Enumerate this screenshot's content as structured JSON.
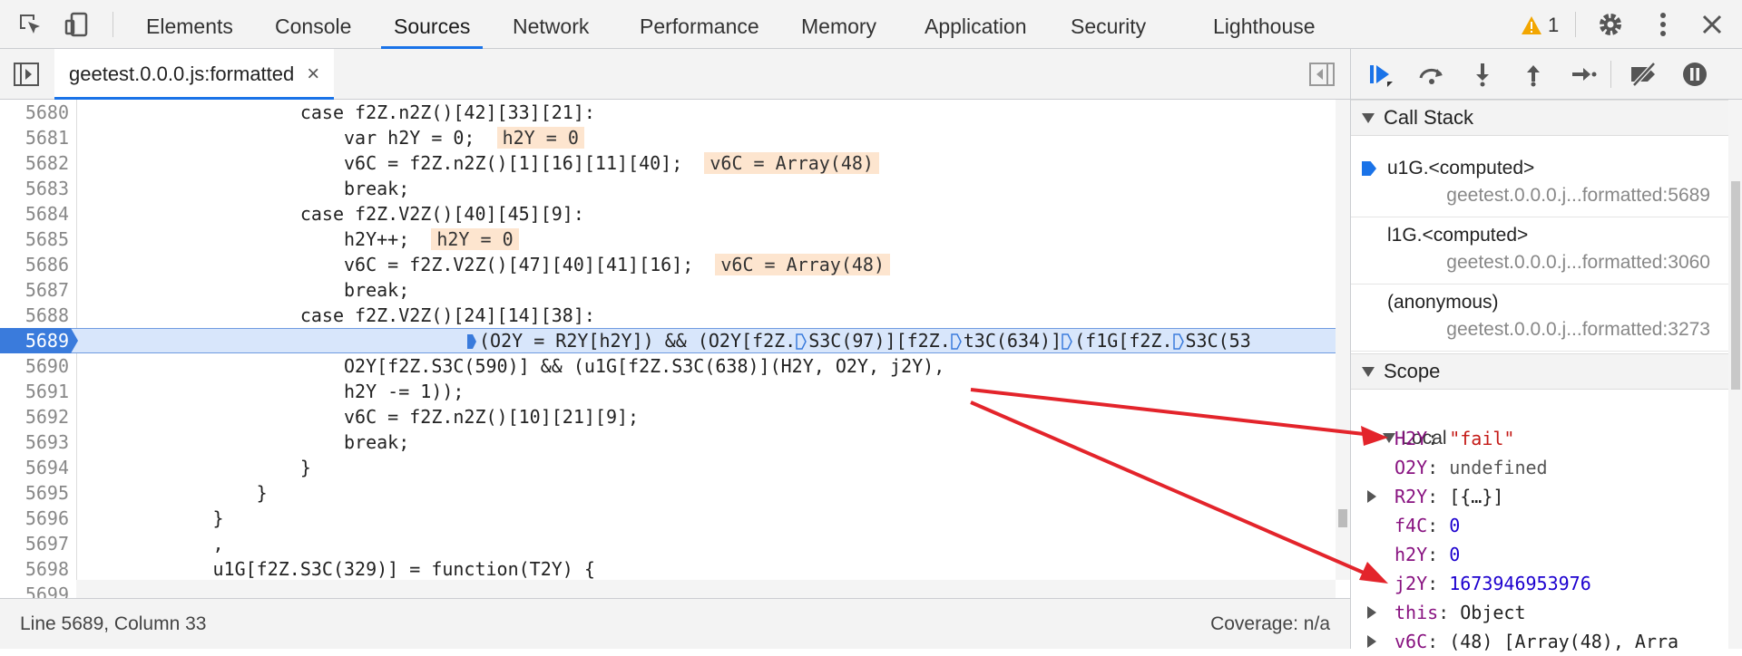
{
  "topbar": {
    "tabs": [
      {
        "label": "Elements"
      },
      {
        "label": "Console"
      },
      {
        "label": "Sources"
      },
      {
        "label": "Network"
      },
      {
        "label": "Performance"
      },
      {
        "label": "Memory"
      },
      {
        "label": "Application"
      },
      {
        "label": "Security"
      },
      {
        "label": "Lighthouse"
      }
    ],
    "active_tab": "Sources",
    "warning_count": "1",
    "icons": [
      "inspect-icon",
      "device-toolbar-icon",
      "warning-icon",
      "gear-icon",
      "more-icon",
      "close-icon"
    ]
  },
  "editor": {
    "file_tab": "geetest.0.0.0.js:formatted",
    "close_glyph": "×",
    "current_line": "5689",
    "lines": [
      {
        "n": "5680",
        "code": "                    case f2Z.n2Z()[42][33][21]:"
      },
      {
        "n": "5681",
        "code": "                        var h2Y = 0;",
        "val": "h2Y = 0"
      },
      {
        "n": "5682",
        "code": "                        v6C = f2Z.n2Z()[1][16][11][40];",
        "val": "v6C = Array(48)"
      },
      {
        "n": "5683",
        "code": "                        break;"
      },
      {
        "n": "5684",
        "code": "                    case f2Z.V2Z()[40][45][9]:"
      },
      {
        "n": "5685",
        "code": "                        h2Y++;",
        "val": "h2Y = 0"
      },
      {
        "n": "5686",
        "code": "                        v6C = f2Z.V2Z()[47][40][41][16];",
        "val": "v6C = Array(48)"
      },
      {
        "n": "5687",
        "code": "                        break;"
      },
      {
        "n": "5688",
        "code": "                    case f2Z.V2Z()[24][14][38]:"
      },
      {
        "n": "5689",
        "code": "(O2Y = R2Y[h2Y]) && (O2Y[f2Z.",
        "code2": "S3C(97)][f2Z.",
        "code3": "t3C(634)]",
        "code4": "(f1G[f2Z.",
        "code5": "S3C(53"
      },
      {
        "n": "5690",
        "code": "                        O2Y[f2Z.S3C(590)] && (u1G[f2Z.S3C(638)](H2Y, O2Y, j2Y),"
      },
      {
        "n": "5691",
        "code": "                        h2Y -= 1));"
      },
      {
        "n": "5692",
        "code": "                        v6C = f2Z.n2Z()[10][21][9];"
      },
      {
        "n": "5693",
        "code": "                        break;"
      },
      {
        "n": "5694",
        "code": "                    }"
      },
      {
        "n": "5695",
        "code": "                }"
      },
      {
        "n": "5696",
        "code": "            }"
      },
      {
        "n": "5697",
        "code": "            ,"
      },
      {
        "n": "5698",
        "code": "            u1G[f2Z.S3C(329)] = function(T2Y) {"
      },
      {
        "n": "5699",
        "code": ""
      }
    ]
  },
  "status": {
    "position": "Line 5689, Column 33",
    "coverage": "Coverage: n/a"
  },
  "debugger": {
    "buttons": [
      "resume-icon",
      "step-over-icon",
      "step-into-icon",
      "step-out-icon",
      "step-icon",
      "deactivate-breakpoints-icon",
      "pause-on-exceptions-icon"
    ],
    "call_stack_title": "Call Stack",
    "frames": [
      {
        "name": "u1G.<computed>",
        "loc": "geetest.0.0.0.j...formatted:5689"
      },
      {
        "name": "l1G.<computed>",
        "loc": "geetest.0.0.0.j...formatted:3060"
      },
      {
        "name": "(anonymous)",
        "loc": "geetest.0.0.0.j...formatted:3273"
      }
    ],
    "scope_title": "Scope",
    "local_title": "Local",
    "scope_vars": [
      {
        "key": "H2Y",
        "value": "\"fail\"",
        "kind": "str"
      },
      {
        "key": "O2Y",
        "value": "undefined",
        "kind": "plain"
      },
      {
        "key": "R2Y",
        "value": "[{…}]",
        "kind": "plain",
        "expandable": true
      },
      {
        "key": "f4C",
        "value": "0",
        "kind": "num"
      },
      {
        "key": "h2Y",
        "value": "0",
        "kind": "num"
      },
      {
        "key": "j2Y",
        "value": "1673946953976",
        "kind": "num"
      },
      {
        "key": "this",
        "value": "Object",
        "kind": "plain",
        "expandable": true
      },
      {
        "key": "v6C",
        "value": "(48) [Array(48), Arra",
        "kind": "plain",
        "expandable": true
      }
    ]
  },
  "colors": {
    "accent": "#1a73e8",
    "annotation": "#e3242b"
  }
}
